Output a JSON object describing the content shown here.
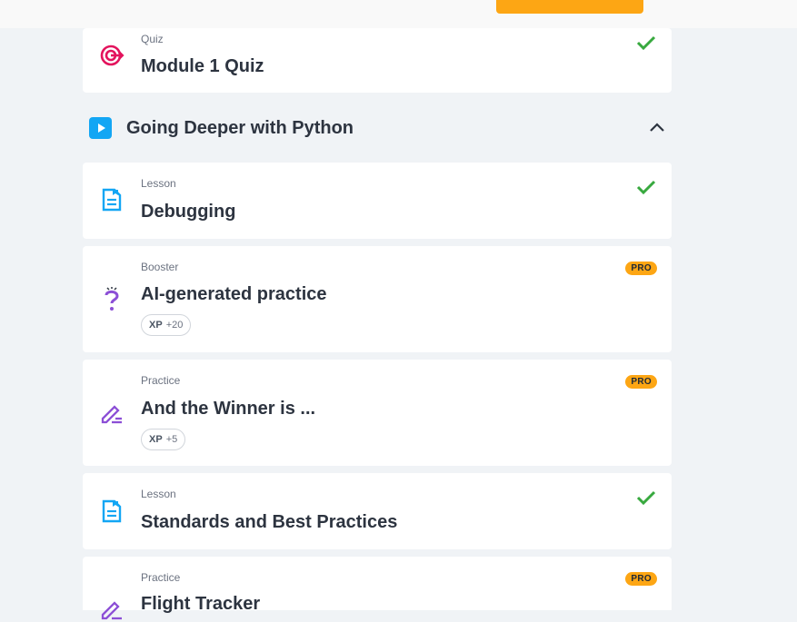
{
  "colors": {
    "accent": "#fda614",
    "check": "#38a93f",
    "lesson_icon": "#13a6f4",
    "quiz_icon": "#e3145d",
    "practice_icon": "#8c4fd6"
  },
  "items_top": [
    {
      "kind": "Quiz",
      "title": "Module 1 Quiz",
      "icon": "target-icon",
      "completed": true
    }
  ],
  "section": {
    "title": "Going Deeper with Python",
    "expanded": true,
    "icon": "play-icon"
  },
  "items": [
    {
      "kind": "Lesson",
      "title": "Debugging",
      "icon": "document-icon",
      "completed": true
    },
    {
      "kind": "Booster",
      "title": "AI-generated practice",
      "icon": "question-sparkle-icon",
      "badge": "PRO",
      "xp_label": "XP",
      "xp_value": "+20"
    },
    {
      "kind": "Practice",
      "title": "And the Winner is ...",
      "icon": "pencil-icon",
      "badge": "PRO",
      "xp_label": "XP",
      "xp_value": "+5"
    },
    {
      "kind": "Lesson",
      "title": "Standards and Best Practices",
      "icon": "document-icon",
      "completed": true
    },
    {
      "kind": "Practice",
      "title": "Flight Tracker",
      "icon": "pencil-icon",
      "badge": "PRO"
    }
  ]
}
